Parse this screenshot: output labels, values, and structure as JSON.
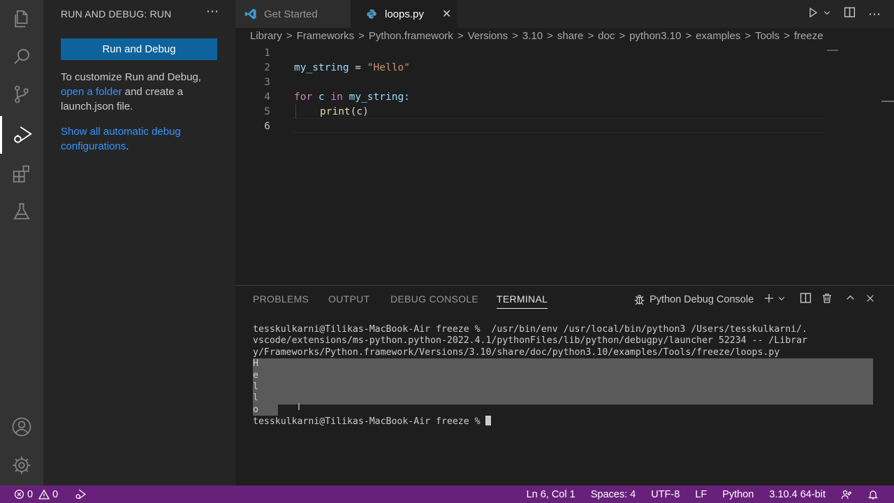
{
  "sidebar": {
    "title": "RUN AND DEBUG: RUN",
    "more": "⋯",
    "run_button": "Run and Debug",
    "info_pre": "To customize Run and Debug,",
    "info_link": "open a folder",
    "info_post": "and create a launch.json file.",
    "show_link": "Show all automatic debug configurations",
    "show_period": "."
  },
  "tabs": {
    "get_started": "Get Started",
    "loops": "loops.py",
    "close": "✕"
  },
  "breadcrumb": [
    "Library",
    "Frameworks",
    "Python.framework",
    "Versions",
    "3.10",
    "share",
    "doc",
    "python3.10",
    "examples",
    "Tools",
    "freeze"
  ],
  "breadcrumb_sep": ">",
  "editor": {
    "line_numbers": [
      "1",
      "2",
      "3",
      "4",
      "5",
      "6"
    ],
    "l2_var": "my_string",
    "l2_op": " = ",
    "l2_str": "\"Hello\"",
    "l4_for": "for",
    "l4_c": " c ",
    "l4_in": "in",
    "l4_rest": " my_string:",
    "l5_fn": "print",
    "l5_args": "(c)"
  },
  "panel": {
    "tabs": [
      "PROBLEMS",
      "OUTPUT",
      "DEBUG CONSOLE",
      "TERMINAL"
    ],
    "console_name": "Python Debug Console"
  },
  "terminal": {
    "line1": "tesskulkarni@Tilikas-MacBook-Air freeze %  /usr/bin/env /usr/local/bin/python3 /Users/tesskulkarni/.",
    "line2": "vscode/extensions/ms-python.python-2022.4.1/pythonFiles/lib/python/debugpy/launcher 52234 -- /Librar",
    "line3": "y/Frameworks/Python.framework/Versions/3.10/share/doc/python3.10/examples/Tools/freeze/loops.py",
    "outputs": [
      "H",
      "e",
      "l",
      "l",
      "o"
    ],
    "prompt": "tesskulkarni@Tilikas-MacBook-Air freeze % "
  },
  "status": {
    "errors": "0",
    "warnings": "0",
    "position": "Ln 6, Col 1",
    "spaces": "Spaces: 4",
    "encoding": "UTF-8",
    "eol": "LF",
    "language": "Python",
    "interpreter": "3.10.4 64-bit"
  },
  "colors": {
    "status_bar": "#68217a",
    "button": "#0e639c",
    "link": "#3794ff"
  }
}
